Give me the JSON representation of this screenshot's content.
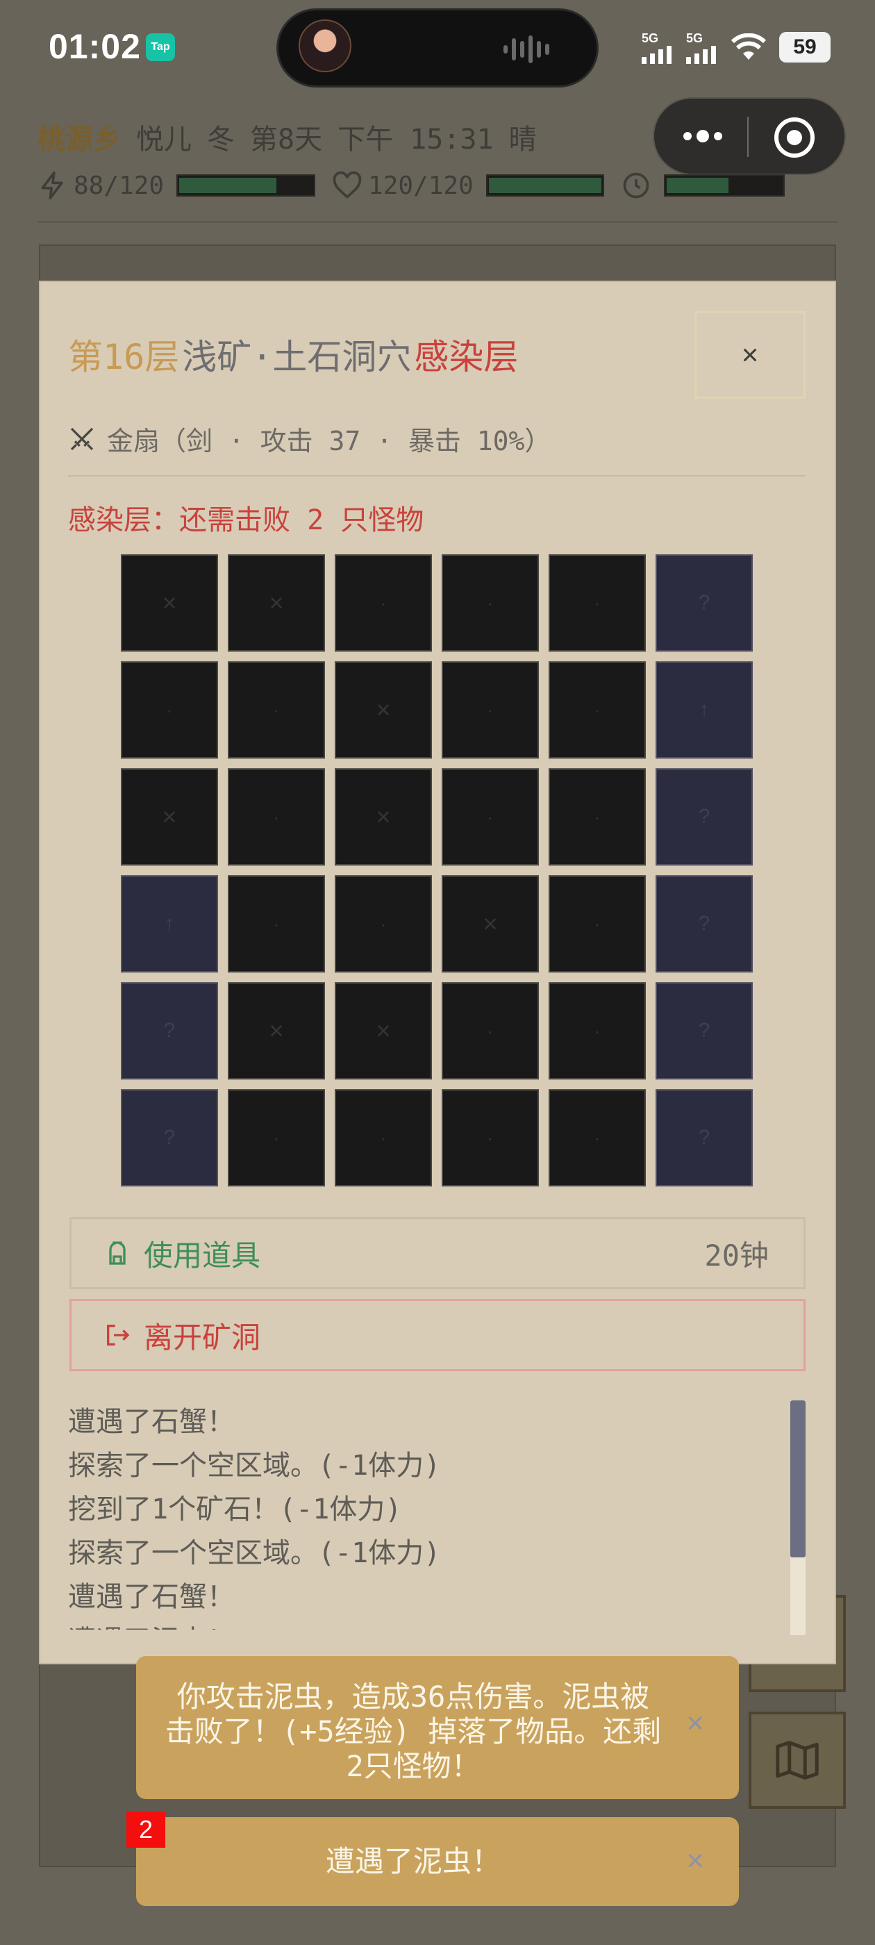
{
  "status_bar": {
    "time": "01:02",
    "app_badge": "Tap",
    "network1": "5G",
    "network2": "5G",
    "battery": "59"
  },
  "header": {
    "location": "桃源乡",
    "character": "悦儿",
    "season": "冬",
    "day": "第8天",
    "time_of_day": "下午 15:31",
    "weather": "晴"
  },
  "stats": {
    "energy": "88/120",
    "energy_fraction": 0.733,
    "health": "120/120",
    "health_fraction": 1.0,
    "time_fraction": 0.55
  },
  "modal": {
    "floor": "第16层",
    "area_name": "浅矿·土石洞穴",
    "tag": "感染层",
    "close_label": "×",
    "weapon": "金扇（剑 · 攻击 37 · 暴击 10%）",
    "infection_notice": "感染层：还需击败 2 只怪物",
    "grid": [
      [
        "x",
        "x",
        "dot",
        "dot",
        "dot",
        "q"
      ],
      [
        "dot",
        "dot",
        "x",
        "dot",
        "dot",
        "up"
      ],
      [
        "x",
        "dot",
        "x",
        "dot",
        "dot",
        "q"
      ],
      [
        "up",
        "dot",
        "dot",
        "x",
        "dot",
        "q"
      ],
      [
        "q",
        "x",
        "x",
        "dot",
        "dot",
        "q"
      ],
      [
        "q",
        "dot",
        "dot",
        "dot",
        "dot",
        "q"
      ]
    ],
    "use_item_label": "使用道具",
    "use_item_cost": "20钟",
    "leave_label": "离开矿洞",
    "log": [
      "遭遇了石蟹！",
      "探索了一个空区域。(-1体力)",
      "挖到了1个矿石！(-1体力)",
      "探索了一个空区域。(-1体力)",
      "遭遇了石蟹！",
      "遭遇了泥虫！"
    ],
    "log_scroll_fraction": 0.67
  },
  "toasts": [
    {
      "message": "你攻击泥虫，造成36点伤害。泥虫被击败了！(+5经验) 掉落了物品。还剩2只怪物！",
      "close": "×"
    },
    {
      "message": "遭遇了泥虫！",
      "close": "×",
      "count": "2"
    }
  ],
  "colors": {
    "accent_gold": "#c89a55",
    "danger_red": "#c9423d",
    "success_green": "#3e8f57",
    "toast_bg": "#c9a35d"
  }
}
